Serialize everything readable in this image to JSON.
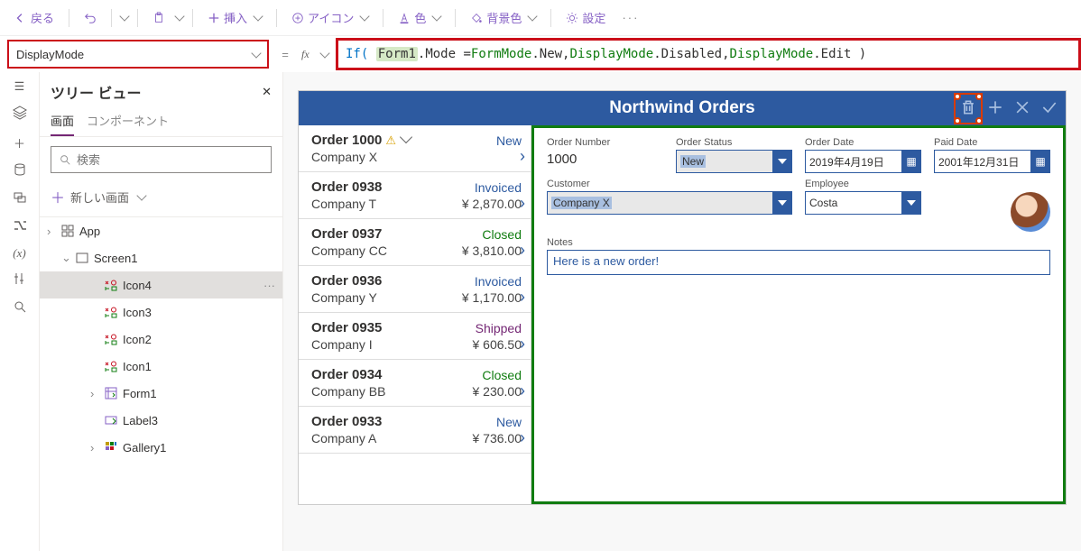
{
  "toolbar": {
    "back": "戻る",
    "insert": "挿入",
    "icon": "アイコン",
    "color": "色",
    "bgcolor": "背景色",
    "settings": "設定"
  },
  "propRow": {
    "property": "DisplayMode",
    "formula": {
      "t1": "If(",
      "form1": "Form1",
      "t2": ".Mode = ",
      "fm": "FormMode",
      "t3": ".New, ",
      "dm1": "DisplayMode",
      "t4": ".Disabled, ",
      "dm2": "DisplayMode",
      "t5": ".Edit )"
    }
  },
  "tree": {
    "title": "ツリー ビュー",
    "tabScreens": "画面",
    "tabComponents": "コンポーネント",
    "searchPlaceholder": "検索",
    "newScreen": "新しい画面",
    "items": [
      {
        "label": "App",
        "depth": 0,
        "chev": "›",
        "icon": "app"
      },
      {
        "label": "Screen1",
        "depth": 1,
        "chev": "⌄",
        "icon": "screen"
      },
      {
        "label": "Icon4",
        "depth": 2,
        "icon": "iconctl",
        "sel": true
      },
      {
        "label": "Icon3",
        "depth": 2,
        "icon": "iconctl"
      },
      {
        "label": "Icon2",
        "depth": 2,
        "icon": "iconctl"
      },
      {
        "label": "Icon1",
        "depth": 2,
        "icon": "iconctl"
      },
      {
        "label": "Form1",
        "depth": 2,
        "chev": "›",
        "icon": "form"
      },
      {
        "label": "Label3",
        "depth": 2,
        "icon": "label"
      },
      {
        "label": "Gallery1",
        "depth": 2,
        "chev": "›",
        "icon": "gallery"
      }
    ]
  },
  "app": {
    "title": "Northwind Orders",
    "orders": [
      {
        "num": "Order 1000",
        "company": "Company X",
        "status": "New",
        "statusCls": "st-new",
        "total": "",
        "warn": true,
        "dd": true
      },
      {
        "num": "Order 0938",
        "company": "Company T",
        "status": "Invoiced",
        "statusCls": "st-invoiced",
        "total": "¥ 2,870.00"
      },
      {
        "num": "Order 0937",
        "company": "Company CC",
        "status": "Closed",
        "statusCls": "st-closed",
        "total": "¥ 3,810.00"
      },
      {
        "num": "Order 0936",
        "company": "Company Y",
        "status": "Invoiced",
        "statusCls": "st-invoiced",
        "total": "¥ 1,170.00"
      },
      {
        "num": "Order 0935",
        "company": "Company I",
        "status": "Shipped",
        "statusCls": "st-shipped",
        "total": "¥ 606.50"
      },
      {
        "num": "Order 0934",
        "company": "Company BB",
        "status": "Closed",
        "statusCls": "st-closed",
        "total": "¥ 230.00"
      },
      {
        "num": "Order 0933",
        "company": "Company A",
        "status": "New",
        "statusCls": "st-new",
        "total": "¥ 736.00"
      }
    ],
    "form": {
      "orderNumLbl": "Order Number",
      "orderNum": "1000",
      "orderStatusLbl": "Order Status",
      "orderStatus": "New",
      "orderDateLbl": "Order Date",
      "orderDate": "2019年4月19日",
      "paidDateLbl": "Paid Date",
      "paidDate": "2001年12月31日",
      "customerLbl": "Customer",
      "customer": "Company X",
      "employeeLbl": "Employee",
      "employee": "Costa",
      "notesLbl": "Notes",
      "notes": "Here is a new order!"
    }
  }
}
